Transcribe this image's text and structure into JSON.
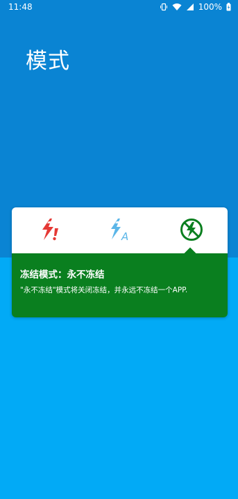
{
  "status_bar": {
    "time": "11:48",
    "battery_percent": "100%",
    "icons": [
      "vibrate-icon",
      "wifi-icon",
      "signal-icon",
      "battery-charging-icon"
    ]
  },
  "page": {
    "title": "模式"
  },
  "modes": [
    {
      "icon": "red-lightning-exclamation-icon",
      "color": "#E53935"
    },
    {
      "icon": "blue-lightning-auto-icon",
      "color": "#5BB6E8"
    },
    {
      "icon": "green-lightning-slash-icon",
      "color": "#0A7F1F",
      "selected": true
    }
  ],
  "description": {
    "title": "冻结模式：永不冻结",
    "text": "\"永不冻结\"模式将关闭冻结，并永远不冻结一个APP."
  },
  "colors": {
    "header_bg": "#0A84D3",
    "body_bg": "#02AAF6",
    "accent_green": "#0A7F1F"
  }
}
